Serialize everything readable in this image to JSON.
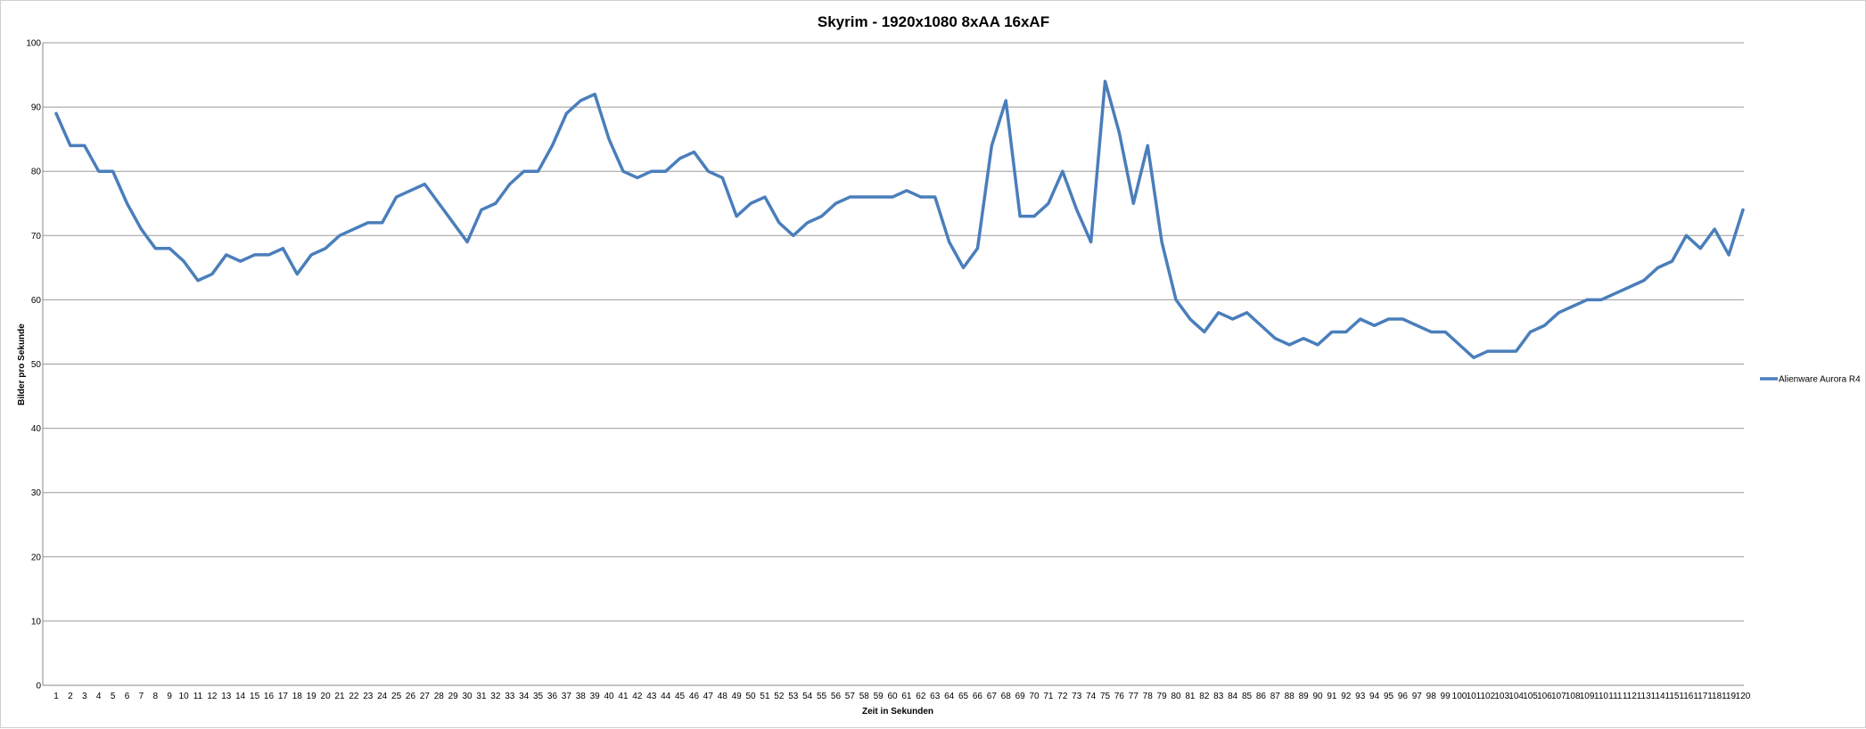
{
  "chart_data": {
    "type": "line",
    "title": "Skyrim - 1920x1080 8xAA 16xAF",
    "xlabel": "Zeit in Sekunden",
    "ylabel": "Bilder pro Sekunde",
    "ylim": [
      0,
      100
    ],
    "ytick_step": 10,
    "grid": true,
    "legend_position": "right",
    "categories": [
      "1",
      "2",
      "3",
      "4",
      "5",
      "6",
      "7",
      "8",
      "9",
      "10",
      "11",
      "12",
      "13",
      "14",
      "15",
      "16",
      "17",
      "18",
      "19",
      "20",
      "21",
      "22",
      "23",
      "24",
      "25",
      "26",
      "27",
      "28",
      "29",
      "30",
      "31",
      "32",
      "33",
      "34",
      "35",
      "36",
      "37",
      "38",
      "39",
      "40",
      "41",
      "42",
      "43",
      "44",
      "45",
      "46",
      "47",
      "48",
      "49",
      "50",
      "51",
      "52",
      "53",
      "54",
      "55",
      "56",
      "57",
      "58",
      "59",
      "60",
      "61",
      "62",
      "63",
      "64",
      "65",
      "66",
      "67",
      "68",
      "69",
      "70",
      "71",
      "72",
      "73",
      "74",
      "75",
      "76",
      "77",
      "78",
      "79",
      "80",
      "81",
      "82",
      "83",
      "84",
      "85",
      "86",
      "87",
      "88",
      "89",
      "90",
      "91",
      "92",
      "93",
      "94",
      "95",
      "96",
      "97",
      "98",
      "99",
      "100",
      "101",
      "102",
      "103",
      "104",
      "105",
      "106",
      "107",
      "108",
      "109",
      "110",
      "111",
      "112",
      "113",
      "114",
      "115",
      "116",
      "117",
      "118",
      "119",
      "120"
    ],
    "series": [
      {
        "name": "Alienware Aurora R4",
        "color": "#4a7ebb",
        "values": [
          89,
          84,
          84,
          80,
          80,
          75,
          71,
          68,
          68,
          66,
          63,
          64,
          67,
          66,
          67,
          67,
          68,
          64,
          67,
          68,
          70,
          71,
          72,
          72,
          76,
          77,
          78,
          75,
          72,
          69,
          74,
          75,
          78,
          80,
          80,
          84,
          89,
          91,
          92,
          85,
          80,
          79,
          80,
          80,
          82,
          83,
          80,
          79,
          73,
          75,
          76,
          72,
          70,
          72,
          73,
          75,
          76,
          76,
          76,
          76,
          77,
          76,
          76,
          69,
          65,
          68,
          84,
          91,
          73,
          73,
          75,
          80,
          74,
          69,
          94,
          86,
          75,
          84,
          69,
          60,
          57,
          55,
          58,
          57,
          58,
          56,
          54,
          53,
          54,
          53,
          55,
          55,
          57,
          56,
          57,
          57,
          56,
          55,
          55,
          53,
          51,
          52,
          52,
          52,
          55,
          56,
          58,
          59,
          60,
          60,
          61,
          62,
          63,
          65,
          66,
          70,
          68,
          71,
          67,
          74
        ]
      }
    ]
  }
}
